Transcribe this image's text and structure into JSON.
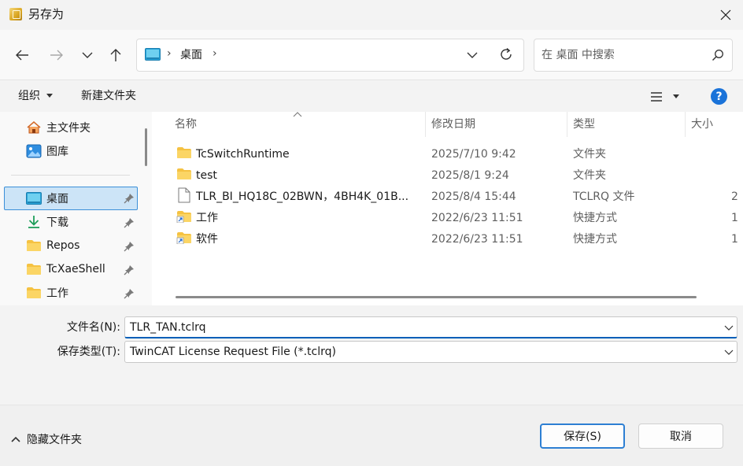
{
  "window": {
    "title": "另存为"
  },
  "address": {
    "location": "桌面",
    "search_placeholder": "在 桌面 中搜索"
  },
  "toolbar": {
    "organize_label": "组织",
    "new_folder_label": "新建文件夹"
  },
  "sidebar": {
    "items": [
      {
        "label": "主文件夹",
        "icon": "home-icon"
      },
      {
        "label": "图库",
        "icon": "gallery-icon"
      },
      {
        "label": "桌面",
        "icon": "desktop-icon",
        "pinned": true,
        "selected": true
      },
      {
        "label": "下载",
        "icon": "download-icon",
        "pinned": true
      },
      {
        "label": "Repos",
        "icon": "folder-icon",
        "pinned": true
      },
      {
        "label": "TcXaeShell",
        "icon": "folder-icon",
        "pinned": true
      },
      {
        "label": "工作",
        "icon": "folder-icon",
        "pinned": true
      }
    ]
  },
  "filelist": {
    "columns": [
      "名称",
      "修改日期",
      "类型",
      "大小"
    ],
    "rows": [
      {
        "name": "TcSwitchRuntime",
        "date": "2025/7/10 9:42",
        "type": "文件夹",
        "size": "",
        "icon": "folder-icon"
      },
      {
        "name": "test",
        "date": "2025/8/1 9:24",
        "type": "文件夹",
        "size": "",
        "icon": "folder-icon"
      },
      {
        "name": "TLR_BI_HQ18C_02BWN，4BH4K_01B...",
        "date": "2025/8/4 15:44",
        "type": "TCLRQ 文件",
        "size": "2",
        "icon": "file-icon"
      },
      {
        "name": "工作",
        "date": "2022/6/23 11:51",
        "type": "快捷方式",
        "size": "1",
        "icon": "folder-shortcut-icon"
      },
      {
        "name": "软件",
        "date": "2022/6/23 11:51",
        "type": "快捷方式",
        "size": "1",
        "icon": "folder-shortcut-icon"
      }
    ]
  },
  "form": {
    "filename_label": "文件名(N):",
    "filename_value": "TLR_TAN.tclrq",
    "filetype_label": "保存类型(T):",
    "filetype_value": "TwinCAT License Request File (*.tclrq)"
  },
  "footer": {
    "hide_folders_label": "隐藏文件夹",
    "save_label": "保存(S)",
    "cancel_label": "取消"
  },
  "colors": {
    "accent": "#005fb8",
    "selection": "#cce4f7",
    "folder": "#f5c242"
  }
}
